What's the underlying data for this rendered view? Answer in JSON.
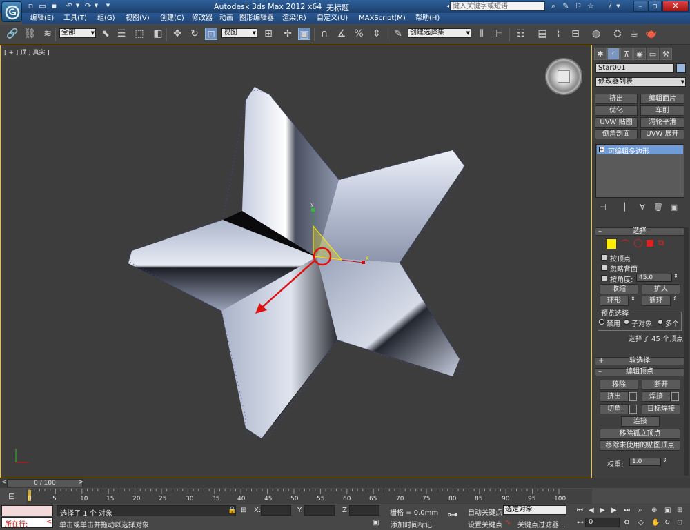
{
  "window": {
    "title": "Autodesk 3ds Max  2012 x64",
    "document": "无标题",
    "search_placeholder": "键入关键字或短语"
  },
  "menus": [
    "编辑(E)",
    "工具(T)",
    "组(G)",
    "视图(V)",
    "创建(C)",
    "修改器",
    "动画",
    "图形编辑器",
    "渲染(R)",
    "自定义(U)",
    "MAXScript(M)",
    "帮助(H)"
  ],
  "toolbar": {
    "selection_filter": "全部",
    "reference_coord": "视图",
    "named_selection": "创建选择集"
  },
  "viewport": {
    "label": "[ + ] 顶 ] 真实 ]"
  },
  "panel": {
    "object_name": "Star001",
    "modifier_list": "修改器列表",
    "modifier_buttons": [
      "挤出",
      "编辑面片",
      "优化",
      "车削",
      "UVW 贴图",
      "涡轮平滑",
      "倒角剖面",
      "UVW 展开"
    ],
    "stack_item": "可编辑多边形",
    "selection": {
      "title": "选择",
      "by_vertex": "按顶点",
      "ignore_backfacing": "忽略背面",
      "by_angle": "按角度:",
      "angle_value": "45.0",
      "shrink": "收缩",
      "grow": "扩大",
      "ring": "环形",
      "loop": "循环",
      "preview_title": "预览选择",
      "preview_off": "禁用",
      "preview_subobj": "子对象",
      "preview_multi": "多个",
      "status": "选择了 45 个顶点"
    },
    "soft_selection_title": "软选择",
    "edit_vertices": {
      "title": "编辑顶点",
      "remove": "移除",
      "break": "断开",
      "extrude": "挤出",
      "weld": "焊接",
      "chamfer": "切角",
      "target_weld": "目标焊接",
      "connect": "连接",
      "remove_isolated": "移除孤立顶点",
      "remove_unused_map": "移除未使用的贴图顶点",
      "weight_label": "权重:",
      "weight_value": "1.0"
    }
  },
  "timeline": {
    "frame": "0 / 100",
    "ticks": [
      "0",
      "5",
      "10",
      "15",
      "20",
      "25",
      "30",
      "35",
      "40",
      "45",
      "50",
      "55",
      "60",
      "65",
      "70",
      "75",
      "80",
      "85",
      "90",
      "95",
      "100"
    ]
  },
  "status": {
    "line1": "选择了 1 个 对象",
    "line2": "单击或单击并拖动以选择对象",
    "listener": "所在行:",
    "x_label": "X:",
    "y_label": "Y:",
    "z_label": "Z:",
    "grid": "栅格 = 0.0mm",
    "add_time_tag": "添加时间标记",
    "auto_key": "自动关键点",
    "set_key": "设置关键点",
    "selected": "选定对象",
    "key_filters": "关键点过滤器...",
    "frame_field": "0"
  },
  "colors": {
    "viewport_border": "#f2c230",
    "title_bar": "#2d5f9a",
    "star_fill": "#a4aec8",
    "selected_vertex": "#ffee00",
    "annotation_arrow": "#e01010"
  }
}
